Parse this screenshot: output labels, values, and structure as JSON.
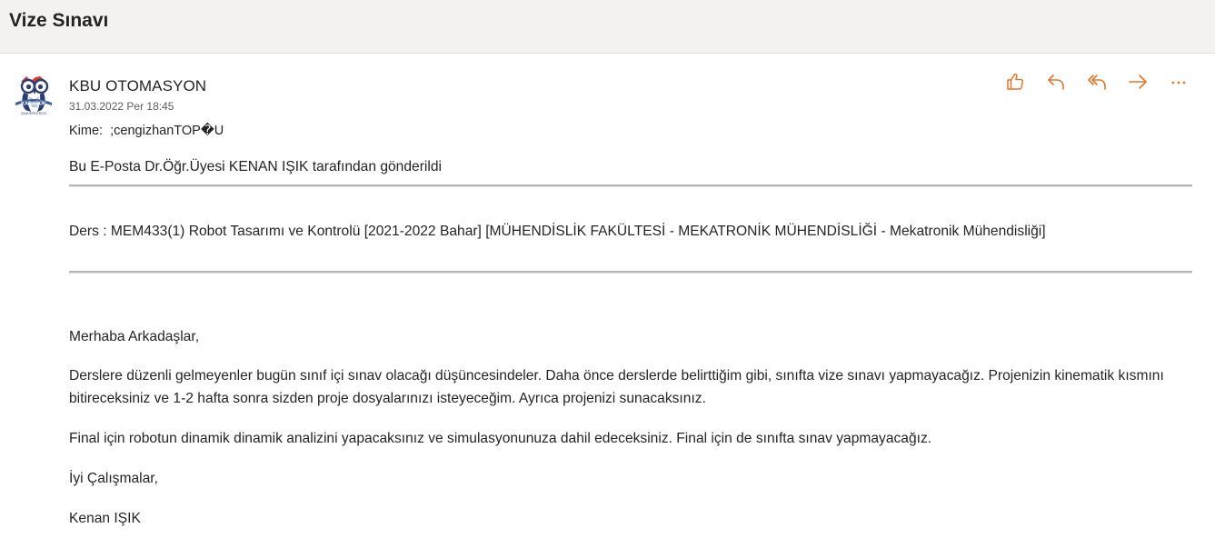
{
  "subject": "Vize Sınavı",
  "sender": {
    "name": "KBU OTOMASYON",
    "date": "31.03.2022 Per 18:45",
    "to_label": "Kime:",
    "to_value": ";cengizhanTOP�U"
  },
  "actions": [
    {
      "name": "like",
      "icon": "thumbs-up-icon"
    },
    {
      "name": "reply",
      "icon": "reply-icon"
    },
    {
      "name": "reply-all",
      "icon": "reply-all-icon"
    },
    {
      "name": "forward",
      "icon": "forward-icon"
    },
    {
      "name": "more",
      "icon": "more-icon"
    }
  ],
  "accent_color": "#e3762b",
  "body": {
    "sent_by": "Bu E-Posta Dr.Öğr.Üyesi KENAN IŞIK tarafından gönderildi",
    "course": "Ders : MEM433(1) Robot Tasarımı ve Kontrolü [2021-2022 Bahar] [MÜHENDİSLİK FAKÜLTESİ - MEKATRONİK MÜHENDİSLİĞİ - Mekatronik Mühendisliği]",
    "greeting": "Merhaba Arkadaşlar,",
    "paragraph1": "Derslere düzenli gelmeyenler bugün sınıf içi sınav olacağı düşüncesindeler. Daha önce derslerde belirttiğim gibi, sınıfta vize sınavı yapmayacağız. Projenizin kinematik kısmını bitireceksiniz ve 1-2 hafta sonra sizden proje dosyalarınızı isteyeceğim. Ayrıca projenizi sunacaksınız.",
    "paragraph2": "Final için robotun dinamik dinamik analizini yapacaksınız ve simulasyonunuza dahil edeceksiniz. Final için de sınıfta sınav yapmayacağız.",
    "closing": "İyi Çalışmalar,",
    "signature": "Kenan IŞIK"
  }
}
